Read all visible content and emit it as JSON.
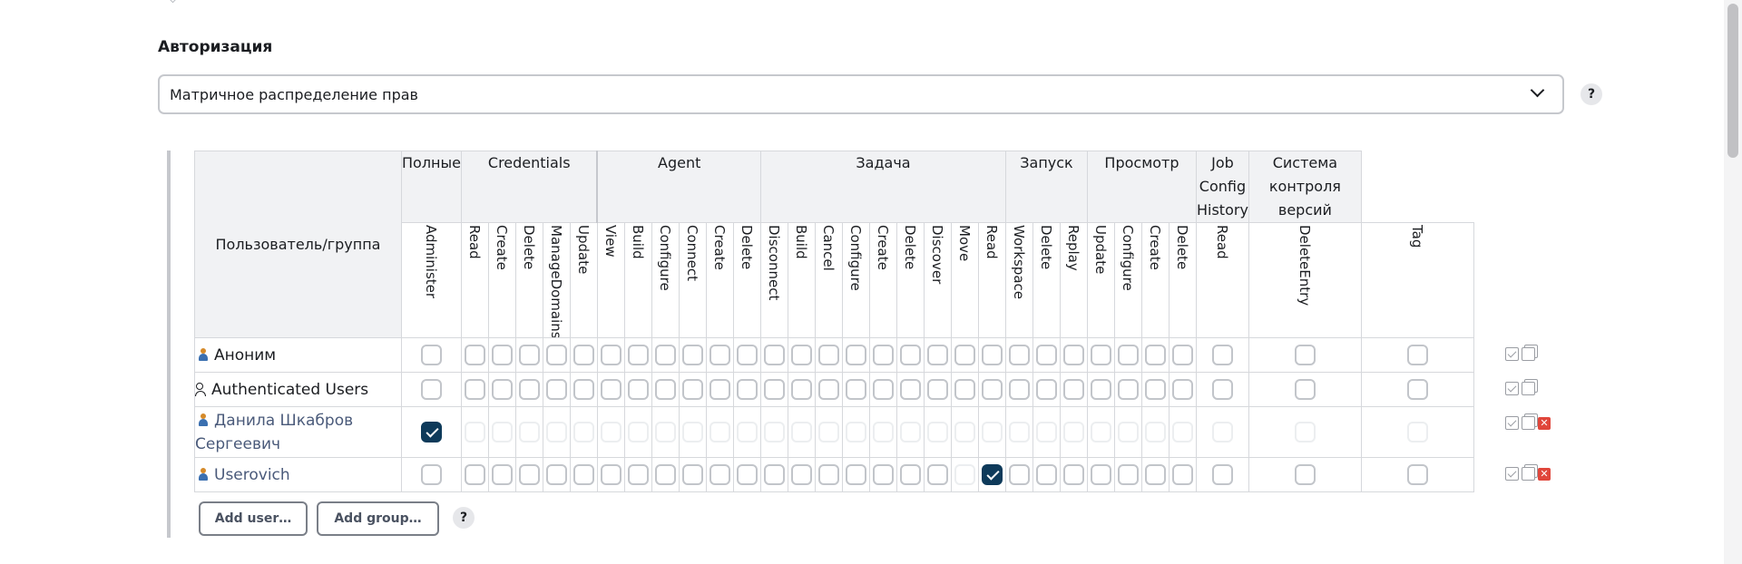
{
  "section": {
    "title": "Авторизация"
  },
  "strategy_select": {
    "value": "Матричное распределение прав"
  },
  "matrix": {
    "user_column_label": "Пользователь/группа",
    "groups": [
      {
        "label": "Полные",
        "span": 1
      },
      {
        "label": "Credentials",
        "span": 5
      },
      {
        "label": "Agent",
        "span": 6
      },
      {
        "label": "Задача",
        "span": 9
      },
      {
        "label": "Запуск",
        "span": 3
      },
      {
        "label": "Просмотр",
        "span": 4
      },
      {
        "label": "Job Config History",
        "span": 1
      },
      {
        "label": "Система контроля версий",
        "span": 1
      }
    ],
    "permissions": [
      "Administer",
      "Read",
      "Create",
      "Delete",
      "ManageDomains",
      "Update",
      "View",
      "Build",
      "Configure",
      "Connect",
      "Create",
      "Delete",
      "Disconnect",
      "Build",
      "Cancel",
      "Configure",
      "Create",
      "Delete",
      "Discover",
      "Move",
      "Read",
      "Workspace",
      "Delete",
      "Replay",
      "Update",
      "Configure",
      "Create",
      "Delete",
      "Read",
      "DeleteEntry",
      "Tag"
    ],
    "rows": [
      {
        "name": "Аноним",
        "type": "user",
        "deletable": false,
        "checked": [],
        "disabled": []
      },
      {
        "name": "Authenticated Users",
        "type": "group",
        "deletable": false,
        "checked": [],
        "disabled": []
      },
      {
        "name": "Данила Шкабров Сергеевич",
        "type": "user",
        "deletable": true,
        "checked": [
          0
        ],
        "disabled": "all-except-checked"
      },
      {
        "name": "Userovich",
        "type": "user",
        "deletable": true,
        "checked": [
          20
        ],
        "disabled": [
          19
        ]
      }
    ]
  },
  "buttons": {
    "add_user": "Add user…",
    "add_group": "Add group…",
    "help": "?"
  },
  "colors": {
    "checked": "#0e3a5a",
    "border": "#c2c5ca",
    "header_bg": "#f1f2f4",
    "delete": "#e0463b"
  }
}
